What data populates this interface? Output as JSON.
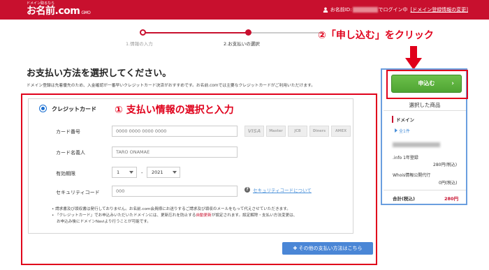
{
  "header": {
    "logo_tagline": "ドメイン取るなら",
    "logo_main": "お名前.com",
    "logo_suffix": "GMO",
    "user_prefix": "お名前ID:",
    "user_suffix": "でログイン中",
    "domain_info_link": "[ドメイン登録情報の変更]"
  },
  "stepper": {
    "steps": [
      "1.情報の入力",
      "2.お支払いの選択"
    ],
    "current": 2
  },
  "annotations": {
    "apply_hint": "②「申し込む」をクリック",
    "payment_hint": "① 支払い情報の選択と入力"
  },
  "main": {
    "heading": "お支払い方法を選択してください。",
    "description": "ドメイン登録は先着優先のため、入金確認が一番早いクレジットカード決済がおすすめです。お名前.comでは主要なクレジットカードがご利用いただけます。"
  },
  "credit_card": {
    "title": "クレジットカード",
    "card_brands": [
      "VISA",
      "Master",
      "JCB",
      "Diners",
      "AMEX"
    ],
    "fields": {
      "number_label": "カード番号",
      "number_placeholder": "0000 0000 0000 0000",
      "name_label": "カード名義人",
      "name_placeholder": "TARO ONAMAE",
      "expiry_label": "有効期限",
      "expiry_month": "1",
      "expiry_separator": "-",
      "expiry_year": "2021",
      "cvv_label": "セキュリティコード",
      "cvv_placeholder": "000",
      "cvv_help": "セキュリティコードについて"
    },
    "notes": [
      "• 請求書及び領収書は発行しておりません。お名前.com会員様にお送りするご請求及び領収のメールをもって代えさせていただきます。",
      "• 「クレジットカード」でお申込みいただいたドメインには、更新忘れを防止する",
      "自動更新",
      "が設定されます。設定解除・支払い方法変更は、",
      "お申込み後にドメインNaviより行うことが可能です。"
    ],
    "other_methods_button": "その他の支払い方法はこちら"
  },
  "sidebar": {
    "apply_button": "申込む",
    "selected_title": "選択した商品",
    "category": "ドメイン",
    "count": "全1件",
    "line1_label": ".info 1年登録",
    "line1_price": "280円(税込)",
    "line2_label": "Whois情報公開代行",
    "line2_price": "0円(税込)",
    "total_label": "合計(税込)",
    "total_value": "280円"
  },
  "colors": {
    "brand_red": "#c8102e",
    "annotation_red": "#e0001b",
    "apply_green": "#5cb23d",
    "link_blue": "#4a90d9",
    "button_blue": "#4a86d6"
  }
}
